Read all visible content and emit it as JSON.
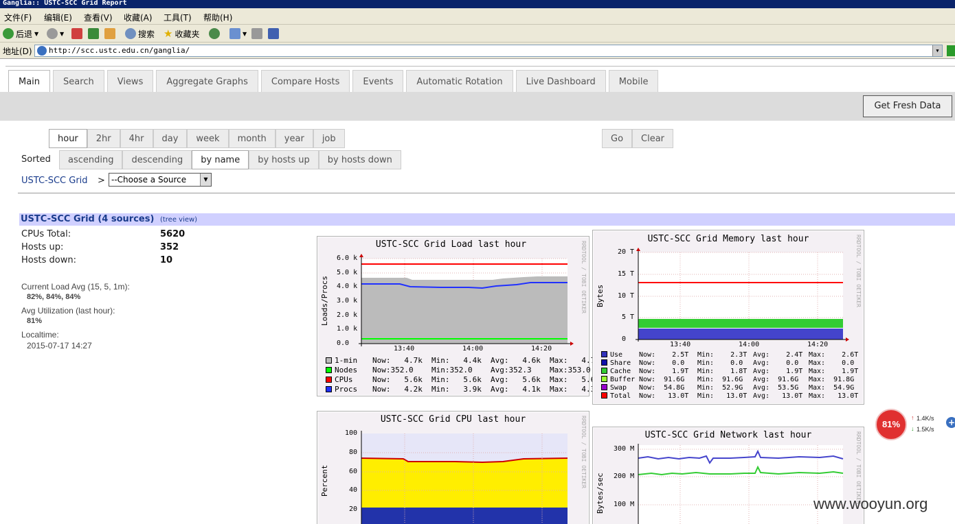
{
  "window": {
    "title": "Ganglia:: USTC-SCC Grid Report"
  },
  "menu": [
    "文件(F)",
    "编辑(E)",
    "查看(V)",
    "收藏(A)",
    "工具(T)",
    "帮助(H)"
  ],
  "toolbar": {
    "back": "后退",
    "search": "搜索",
    "favorites": "收藏夹"
  },
  "address": {
    "label": "地址(D)",
    "url": "http://scc.ustc.edu.cn/ganglia/"
  },
  "tabs": [
    "Main",
    "Search",
    "Views",
    "Aggregate Graphs",
    "Compare Hosts",
    "Events",
    "Automatic Rotation",
    "Live Dashboard",
    "Mobile"
  ],
  "fresh_button": "Get Fresh Data",
  "ranges": [
    "hour",
    "2hr",
    "4hr",
    "day",
    "week",
    "month",
    "year",
    "job"
  ],
  "go": "Go",
  "clear": "Clear",
  "sort": {
    "label": "Sorted",
    "options": [
      "ascending",
      "descending",
      "by name",
      "by hosts up",
      "by hosts down"
    ]
  },
  "breadcrumb": {
    "grid": "USTC-SCC Grid",
    "sep": ">",
    "source_select": "--Choose a Source"
  },
  "grid_header": {
    "title": "USTC-SCC Grid (4 sources)",
    "tree_view": "(tree view)"
  },
  "stats": {
    "cpus_label": "CPUs Total:",
    "cpus": "5620",
    "hosts_up_label": "Hosts up:",
    "hosts_up": "352",
    "hosts_down_label": "Hosts down:",
    "hosts_down": "10",
    "load_label": "Current Load Avg (15, 5, 1m):",
    "load": "82%, 84%, 84%",
    "util_label": "Avg Utilization (last hour):",
    "util": "81%",
    "localtime_label": "Localtime:",
    "localtime": "2015-07-17 14:27"
  },
  "load_graph": {
    "title": "USTC-SCC Grid Load last hour",
    "ylabel": "Loads/Procs",
    "side": "RRDTOOL / TOBI OETIKER",
    "yticks": [
      "6.0 k",
      "5.0 k",
      "4.0 k",
      "3.0 k",
      "2.0 k",
      "1.0 k",
      "0.0"
    ],
    "xticks": [
      "13:40",
      "14:00",
      "14:20"
    ],
    "legend": [
      {
        "name": "1-min",
        "color": "#bbbbbb",
        "now": "Now:   4.7k",
        "min": "Min:   4.4k",
        "avg": "Avg:   4.6k",
        "max": "Max:   4.7"
      },
      {
        "name": "Nodes",
        "color": "#00ff00",
        "now": "Now:352.0",
        "min": "Min:352.0",
        "avg": "Avg:352.3",
        "max": "Max:353.0"
      },
      {
        "name": "CPUs",
        "color": "#ff0000",
        "now": "Now:   5.6k",
        "min": "Min:   5.6k",
        "avg": "Avg:   5.6k",
        "max": "Max:   5.6"
      },
      {
        "name": "Procs",
        "color": "#2030ff",
        "now": "Now:   4.2k",
        "min": "Min:   3.9k",
        "avg": "Avg:   4.1k",
        "max": "Max:   4.3"
      }
    ]
  },
  "memory_graph": {
    "title": "USTC-SCC Grid Memory last hour",
    "ylabel": "Bytes",
    "side": "RRDTOOL / TOBI OETIKER",
    "yticks": [
      "20 T",
      "15 T",
      "10 T",
      "5 T",
      "0"
    ],
    "xticks": [
      "13:40",
      "14:00",
      "14:20"
    ],
    "legend": [
      {
        "name": "Use",
        "color": "#3333bb",
        "now": "Now:    2.5T",
        "min": "Min:    2.3T",
        "avg": "Avg:    2.4T",
        "max": "Max:    2.6T"
      },
      {
        "name": "Share",
        "color": "#1111aa",
        "now": "Now:    0.0",
        "min": "Min:    0.0",
        "avg": "Avg:    0.0",
        "max": "Max:    0.0"
      },
      {
        "name": "Cache",
        "color": "#33cc33",
        "now": "Now:    1.9T",
        "min": "Min:    1.8T",
        "avg": "Avg:    1.9T",
        "max": "Max:    1.9T"
      },
      {
        "name": "Buffer",
        "color": "#99ff33",
        "now": "Now:  91.6G",
        "min": "Min:  91.6G",
        "avg": "Avg:  91.6G",
        "max": "Max:  91.8G"
      },
      {
        "name": "Swap",
        "color": "#9900cc",
        "now": "Now:  54.8G",
        "min": "Min:  52.9G",
        "avg": "Avg:  53.5G",
        "max": "Max:  54.9G"
      },
      {
        "name": "Total",
        "color": "#ff0000",
        "now": "Now:   13.0T",
        "min": "Min:   13.0T",
        "avg": "Avg:   13.0T",
        "max": "Max:   13.0T"
      }
    ]
  },
  "cpu_graph": {
    "title": "USTC-SCC Grid CPU last hour",
    "ylabel": "Percent",
    "side": "RRDTOOL / TOBI OETIKER",
    "yticks": [
      "100",
      "80",
      "60",
      "40",
      "20"
    ]
  },
  "network_graph": {
    "title": "USTC-SCC Grid Network last hour",
    "ylabel": "Bytes/sec",
    "side": "RRDTOOL / TOBI OETIKER",
    "yticks": [
      "300 M",
      "200 M",
      "100 M"
    ]
  },
  "net_widget": {
    "percent": "81%",
    "up": "1.4K/s",
    "down": "1.5K/s"
  },
  "watermark": "www.wooyun.org"
}
